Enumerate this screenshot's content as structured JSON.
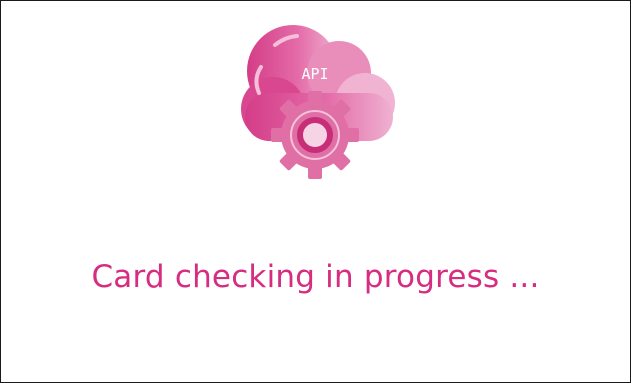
{
  "illustration": {
    "cloud_label": "API",
    "icon_names": [
      "cloud-icon",
      "gear-icon"
    ],
    "colors": {
      "cloud_dark": "#d43d88",
      "cloud_mid": "#e76aa9",
      "cloud_light": "#efa9cc",
      "gear": "#e06fa6",
      "gear_ring": "#c72e77"
    }
  },
  "status": {
    "message": "Card checking in progress ...",
    "color": "#d62d80"
  }
}
